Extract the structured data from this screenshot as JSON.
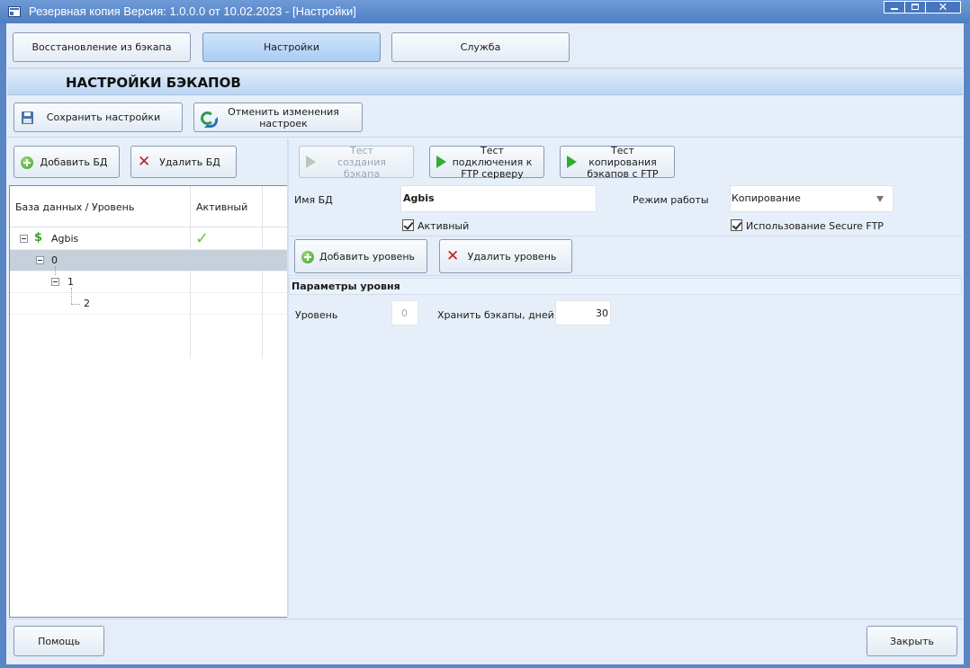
{
  "window": {
    "title": "Резервная копия   Версия: 1.0.0.0 от 10.02.2023 - [Настройки]"
  },
  "tabs": [
    {
      "label": "Восстановление из бэкапа",
      "active": false
    },
    {
      "label": "Настройки",
      "active": true
    },
    {
      "label": "Служба",
      "active": false
    }
  ],
  "header": {
    "title": "НАСТРОЙКИ БЭКАПОВ"
  },
  "toolbar": {
    "save_label": "Сохранить настройки",
    "revert_label": "Отменить изменения настроек"
  },
  "left": {
    "add_db_label": "Добавить БД",
    "delete_db_label": "Удалить БД",
    "grid": {
      "columns": [
        "База данных / Уровень",
        "Активный"
      ],
      "rows": [
        {
          "label": "Agbis",
          "active": true,
          "icon": "dollar-icon"
        },
        {
          "label": "0",
          "selected": true
        },
        {
          "label": "1"
        },
        {
          "label": "2"
        }
      ]
    }
  },
  "right": {
    "test_create_label": "Тест создания бэкапа",
    "test_ftp_label": "Тест подключения к FTP серверу",
    "test_copy_label": "Тест копирования бэкапов с FTP",
    "db_name_label": "Имя БД",
    "db_name_value": "Agbis",
    "mode_label": "Режим работы",
    "mode_value": "Копирование",
    "active_checkbox_label": "Активный",
    "sftp_checkbox_label": "Использование Secure FTP",
    "add_level_label": "Добавить уровень",
    "delete_level_label": "Удалить уровень",
    "level_params_title": "Параметры уровня",
    "level_label": "Уровень",
    "level_value": "0",
    "keep_days_label": "Хранить бэкапы, дней",
    "keep_days_value": "30"
  },
  "footer": {
    "help_label": "Помощь",
    "close_label": "Закрыть"
  },
  "colors": {
    "accent": "#5b86c5",
    "active_tab": "#a9cdf3",
    "background": "#e6eff9"
  }
}
